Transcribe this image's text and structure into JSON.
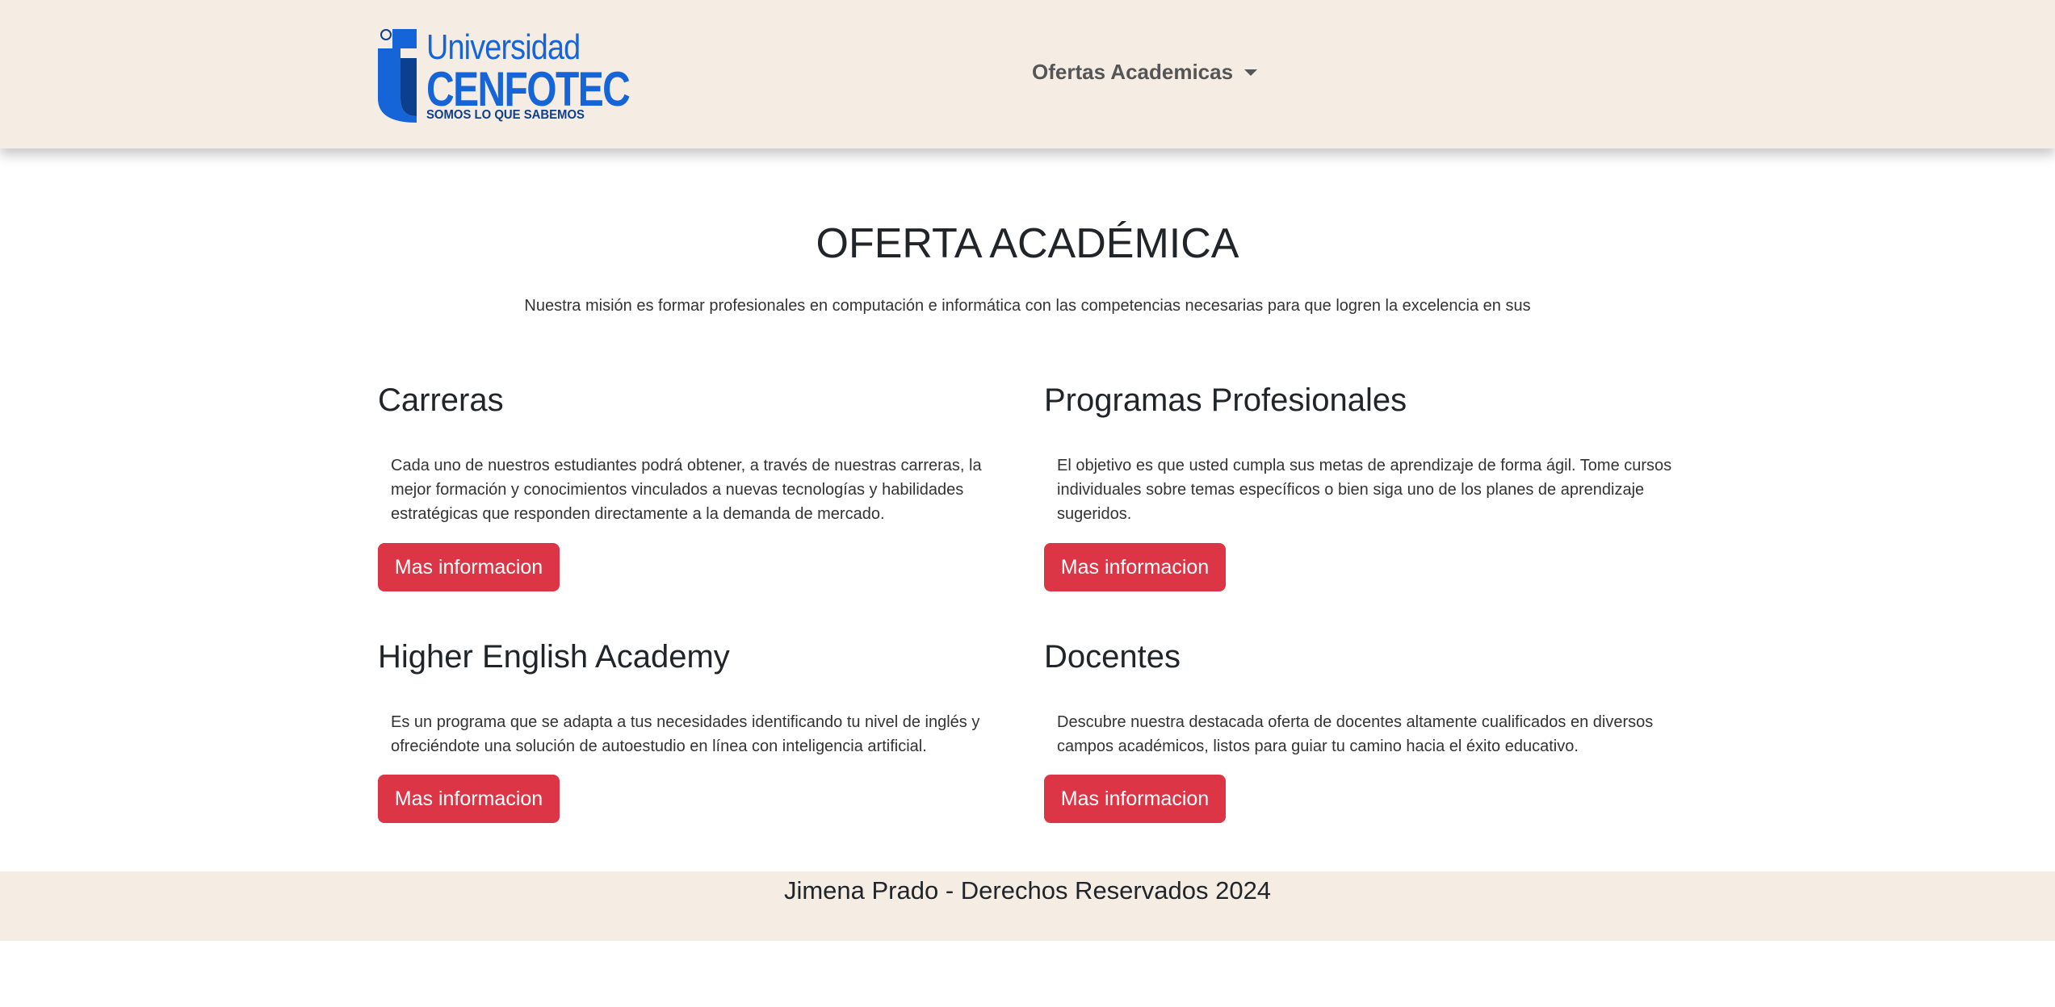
{
  "brand": {
    "line1": "Universidad",
    "line2": "CENFOTEC",
    "tagline": "SOMOS LO QUE SABEMOS",
    "registered": "®",
    "color_primary": "#1565d8",
    "color_dark": "#0d3f8f"
  },
  "nav": {
    "dropdown_label": "Ofertas Academicas"
  },
  "hero": {
    "title": "OFERTA ACADÉMICA",
    "lead": "Nuestra misión es formar profesionales en computación e informática con las competencias necesarias para que logren la excelencia en sus"
  },
  "cards": [
    {
      "title": "Carreras",
      "text": "Cada uno de nuestros estudiantes podrá obtener, a través de nuestras carreras, la mejor formación y conocimientos vinculados a nuevas tecnologías y habilidades estratégicas que responden directamente a la demanda de mercado.",
      "button": "Mas informacion"
    },
    {
      "title": "Programas Profesionales",
      "text": "El objetivo es que usted cumpla sus metas de aprendizaje de forma ágil. Tome cursos individuales sobre temas específicos o bien siga uno de los planes de aprendizaje sugeridos.",
      "button": "Mas informacion"
    },
    {
      "title": "Higher English Academy",
      "text": "Es un programa que se adapta a tus necesidades identificando tu nivel de inglés y ofreciéndote una solución de autoestudio en línea con inteligencia artificial.",
      "button": "Mas informacion"
    },
    {
      "title": "Docentes",
      "text": "Descubre nuestra destacada oferta de docentes altamente cualificados en diversos campos académicos, listos para guiar tu camino hacia el éxito educativo.",
      "button": "Mas informacion"
    }
  ],
  "footer": {
    "text": "Jimena Prado - Derechos Reservados 2024"
  },
  "colors": {
    "header_bg": "#f5ede3",
    "button_bg": "#dc3545"
  }
}
